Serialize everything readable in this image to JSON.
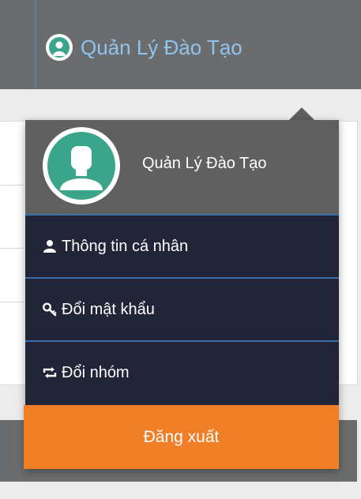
{
  "header": {
    "user_label": "Quản Lý Đào Tạo",
    "avatar_icon": "user-avatar-icon"
  },
  "dropdown": {
    "user_name": "Quản Lý Đào Tạo",
    "avatar_icon": "user-avatar-icon",
    "items": [
      {
        "label": "Thông tin cá nhân",
        "icon": "user-icon"
      },
      {
        "label": "Đổi mật khẩu",
        "icon": "key-icon"
      },
      {
        "label": "Đổi nhóm",
        "icon": "swap-icon"
      }
    ],
    "logout_label": "Đăng xuất"
  },
  "colors": {
    "topbar": "#6b6c6d",
    "dropdown_bg": "#222437",
    "header_bg": "#5f605f",
    "avatar_green": "#3aa58b",
    "logout_orange": "#f07e26",
    "link_blue": "#8fc4ee"
  }
}
